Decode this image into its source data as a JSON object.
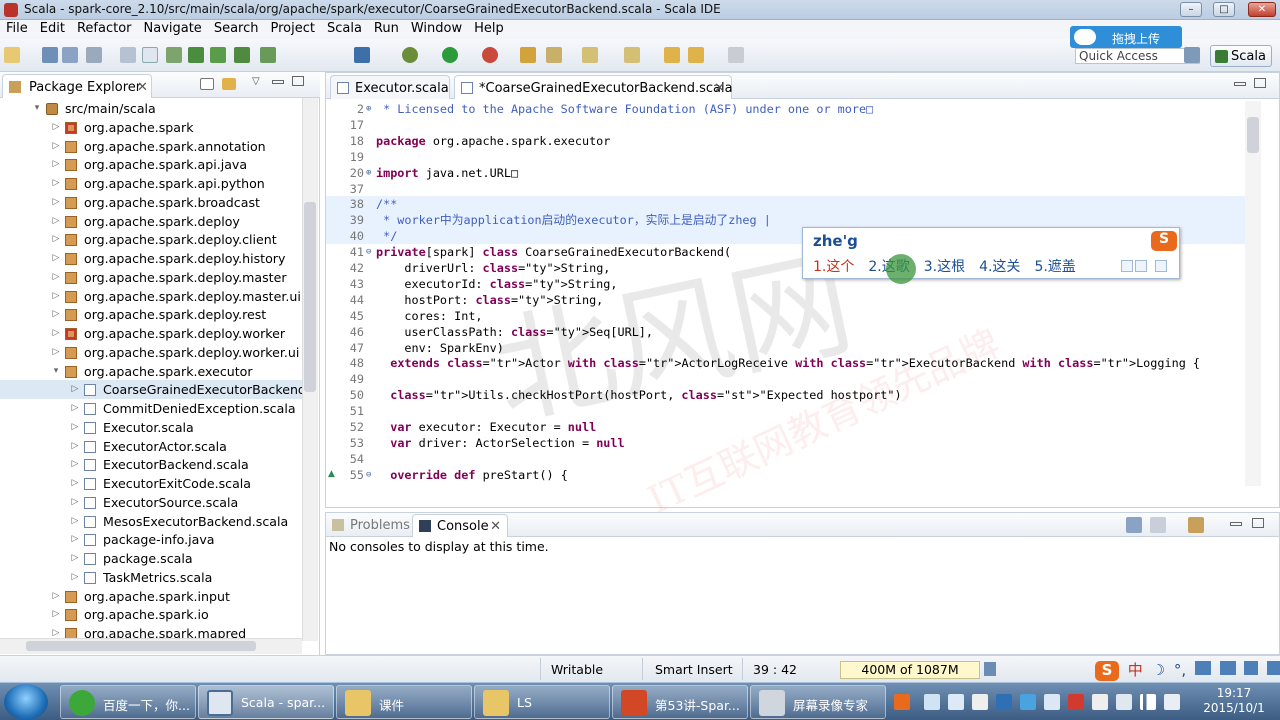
{
  "window": {
    "title": "Scala - spark-core_2.10/src/main/scala/org/apache/spark/executor/CoarseGrainedExecutorBackend.scala - Scala IDE",
    "min": "–",
    "max": "□",
    "close": "✕"
  },
  "menu": [
    "File",
    "Edit",
    "Refactor",
    "Navigate",
    "Search",
    "Project",
    "Scala",
    "Run",
    "Window",
    "Help"
  ],
  "toolbar": {
    "upload_label": "拖拽上传",
    "quick_access": "Quick Access",
    "perspective": "Scala"
  },
  "package_explorer": {
    "tab_label": "Package Explorer",
    "close": "✕",
    "rows": [
      {
        "label": "src/main/scala",
        "icon": "source-folder-icon"
      },
      {
        "label": "org.apache.spark",
        "icon": "package-icon"
      },
      {
        "label": "org.apache.spark.annotation",
        "icon": "package-icon"
      },
      {
        "label": "org.apache.spark.api.java",
        "icon": "package-icon"
      },
      {
        "label": "org.apache.spark.api.python",
        "icon": "package-icon"
      },
      {
        "label": "org.apache.spark.broadcast",
        "icon": "package-icon"
      },
      {
        "label": "org.apache.spark.deploy",
        "icon": "package-icon"
      },
      {
        "label": "org.apache.spark.deploy.client",
        "icon": "package-icon"
      },
      {
        "label": "org.apache.spark.deploy.history",
        "icon": "package-icon"
      },
      {
        "label": "org.apache.spark.deploy.master",
        "icon": "package-icon"
      },
      {
        "label": "org.apache.spark.deploy.master.ui",
        "icon": "package-icon"
      },
      {
        "label": "org.apache.spark.deploy.rest",
        "icon": "package-icon"
      },
      {
        "label": "org.apache.spark.deploy.worker",
        "icon": "package-icon"
      },
      {
        "label": "org.apache.spark.deploy.worker.ui",
        "icon": "package-icon"
      },
      {
        "label": "org.apache.spark.executor",
        "icon": "package-icon"
      },
      {
        "label": "CoarseGrainedExecutorBackend.s",
        "icon": "scala-file-icon"
      },
      {
        "label": "CommitDeniedException.scala",
        "icon": "scala-file-icon"
      },
      {
        "label": "Executor.scala",
        "icon": "scala-file-icon"
      },
      {
        "label": "ExecutorActor.scala",
        "icon": "scala-file-icon"
      },
      {
        "label": "ExecutorBackend.scala",
        "icon": "scala-file-icon"
      },
      {
        "label": "ExecutorExitCode.scala",
        "icon": "scala-file-icon"
      },
      {
        "label": "ExecutorSource.scala",
        "icon": "scala-file-icon"
      },
      {
        "label": "MesosExecutorBackend.scala",
        "icon": "scala-file-icon"
      },
      {
        "label": "package-info.java",
        "icon": "java-file-icon"
      },
      {
        "label": "package.scala",
        "icon": "scala-file-icon"
      },
      {
        "label": "TaskMetrics.scala",
        "icon": "scala-file-icon"
      },
      {
        "label": "org.apache.spark.input",
        "icon": "package-icon"
      },
      {
        "label": "org.apache.spark.io",
        "icon": "package-icon"
      },
      {
        "label": "org.apache.spark.mapred",
        "icon": "package-icon"
      }
    ]
  },
  "editor": {
    "tabs": [
      {
        "label": "Executor.scala"
      },
      {
        "label": "*CoarseGrainedExecutorBackend.scala",
        "close": "✕"
      }
    ],
    "lines": [
      {
        "n": "2",
        "fold": "⊕",
        "text": " * Licensed to the Apache Software Foundation (ASF) under one or more□"
      },
      {
        "n": "17",
        "fold": "",
        "text": ""
      },
      {
        "n": "18",
        "fold": "",
        "text": "package org.apache.spark.executor"
      },
      {
        "n": "19",
        "fold": "",
        "text": ""
      },
      {
        "n": "20",
        "fold": "⊕",
        "text": "import java.net.URL□"
      },
      {
        "n": "37",
        "fold": "",
        "text": ""
      },
      {
        "n": "38",
        "fold": "",
        "text": "/**"
      },
      {
        "n": "39",
        "fold": "",
        "text": " * worker中为application启动的executor，实际上是启动了zheg |"
      },
      {
        "n": "40",
        "fold": "",
        "text": " */"
      },
      {
        "n": "41",
        "fold": "⊖",
        "text": "private[spark] class CoarseGrainedExecutorBackend("
      },
      {
        "n": "42",
        "fold": "",
        "text": "    driverUrl: String,"
      },
      {
        "n": "43",
        "fold": "",
        "text": "    executorId: String,"
      },
      {
        "n": "44",
        "fold": "",
        "text": "    hostPort: String,"
      },
      {
        "n": "45",
        "fold": "",
        "text": "    cores: Int,"
      },
      {
        "n": "46",
        "fold": "",
        "text": "    userClassPath: Seq[URL],"
      },
      {
        "n": "47",
        "fold": "",
        "text": "    env: SparkEnv)"
      },
      {
        "n": "48",
        "fold": "",
        "text": "  extends Actor with ActorLogReceive with ExecutorBackend with Logging {"
      },
      {
        "n": "49",
        "fold": "",
        "text": ""
      },
      {
        "n": "50",
        "fold": "",
        "text": "  Utils.checkHostPort(hostPort, \"Expected hostport\")"
      },
      {
        "n": "51",
        "fold": "",
        "text": ""
      },
      {
        "n": "52",
        "fold": "",
        "text": "  var executor: Executor = null"
      },
      {
        "n": "53",
        "fold": "",
        "text": "  var driver: ActorSelection = null"
      },
      {
        "n": "54",
        "fold": "",
        "text": ""
      },
      {
        "n": "55",
        "fold": "⊖",
        "text": "  override def preStart() {"
      }
    ]
  },
  "ime": {
    "input": "zhe'g",
    "logo": "S",
    "candidates": [
      "1.这个",
      "2.这歌",
      "3.这根",
      "4.这关",
      "5.遮盖"
    ]
  },
  "watermark": {
    "big": "北风网",
    "sub": "IT互联网教育领先品牌"
  },
  "console": {
    "tabs": [
      {
        "label": "Problems"
      },
      {
        "label": "Console",
        "close": "✕"
      }
    ],
    "message": "No consoles to display at this time."
  },
  "status": {
    "writable": "Writable",
    "insert_mode": "Smart Insert",
    "position": "39 : 42",
    "heap": "400M of 1087M"
  },
  "tray_ime": {
    "logo": "S",
    "lang": "中",
    "moon": "☽",
    "punct": "°,"
  },
  "taskbar": {
    "items": [
      {
        "label": "百度一下，你..."
      },
      {
        "label": "Scala - spar..."
      },
      {
        "label": "课件"
      },
      {
        "label": "LS"
      },
      {
        "label": "第53讲-Spar..."
      },
      {
        "label": "屏幕录像专家"
      }
    ],
    "time": "19:17",
    "date": "2015/10/1"
  }
}
